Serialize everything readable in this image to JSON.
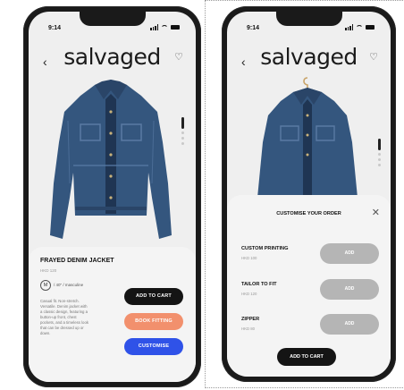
{
  "colors": {
    "brand": "#1b1b1b",
    "add_to_cart": "#141414",
    "book_fitting": "#f2906d",
    "customise": "#2f52e8",
    "add_disabled": "#b5b5b5"
  },
  "phone_left": {
    "status_time": "9:14",
    "brand": "salvaged",
    "product": {
      "name": "FRAYED DENIM JACKET",
      "price": "HKD 120",
      "size": "M",
      "fit_note": "/ 40\" / masculine",
      "description": "Casual fit. Non-stretch. Versatile. Denim jacket with a classic design, featuring a button-up front, chest pockets, and a timeless look that can be dressed up or down."
    },
    "buttons": {
      "add_to_cart": "ADD TO CART",
      "book_fitting": "BOOK FITTING",
      "customise": "CUSTOMISE"
    }
  },
  "phone_right": {
    "status_time": "9:14",
    "brand": "salvaged",
    "sheet": {
      "title": "CUSTOMISE YOUR ORDER",
      "close": "✕",
      "options": [
        {
          "name": "CUSTOM PRINTING",
          "price": "HKD 100",
          "action": "ADD"
        },
        {
          "name": "TAILOR TO FIT",
          "price": "HKD 120",
          "action": "ADD"
        },
        {
          "name": "ZIPPER",
          "price": "HKD 80",
          "action": "ADD"
        }
      ],
      "add_to_cart": "ADD TO CART"
    }
  },
  "icons": {
    "back": "back-arrow-icon",
    "favorite": "heart-icon",
    "close": "close-icon",
    "signal": "signal-icon",
    "wifi": "wifi-icon",
    "battery": "battery-icon"
  }
}
